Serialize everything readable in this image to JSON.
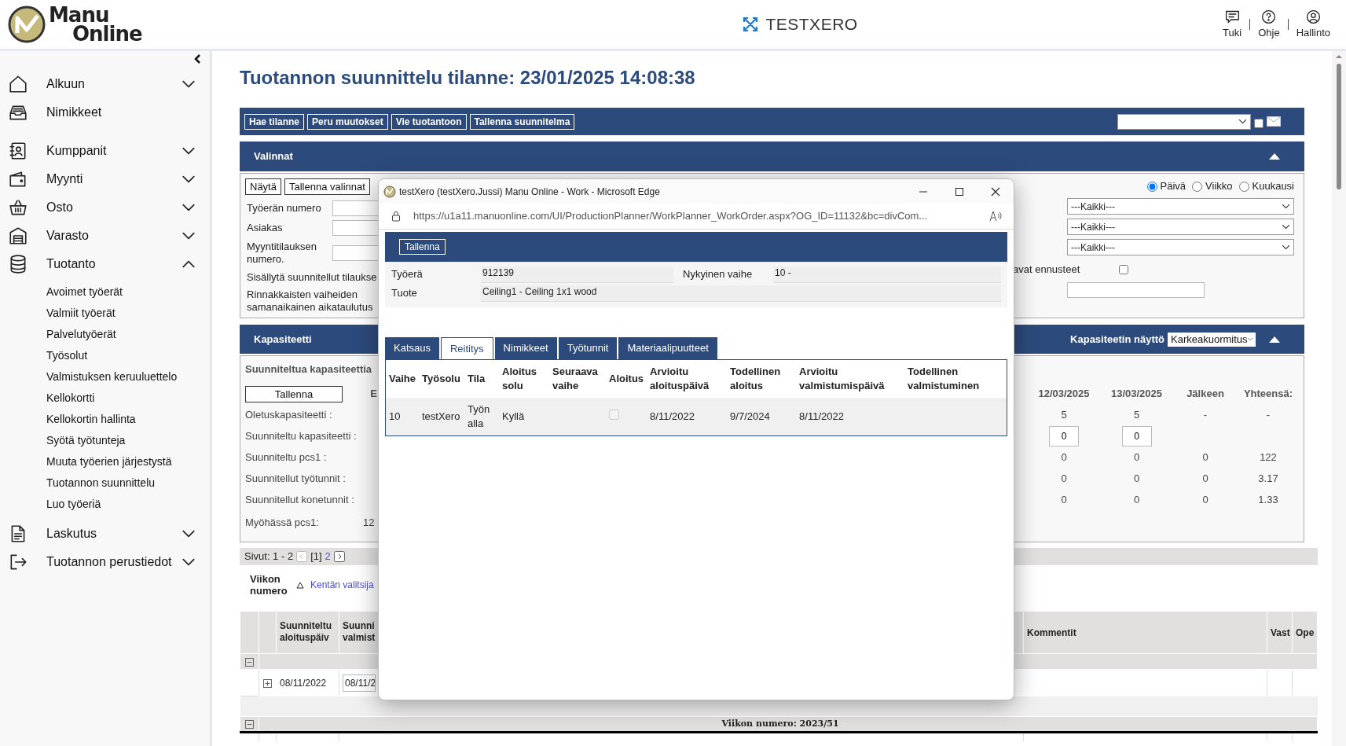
{
  "header": {
    "brand_top": "Manu",
    "brand_bottom": "Online",
    "company": "TESTXERO",
    "links": [
      {
        "label": "Tuki"
      },
      {
        "label": "Ohje"
      },
      {
        "label": "Hallinto"
      }
    ]
  },
  "sidebar": {
    "items": [
      {
        "label": "Alkuun",
        "kind": "group",
        "expanded": false
      },
      {
        "label": "Nimikkeet",
        "kind": "link"
      },
      {
        "label": "Kumppanit",
        "kind": "group",
        "expanded": false
      },
      {
        "label": "Myynti",
        "kind": "group",
        "expanded": false
      },
      {
        "label": "Osto",
        "kind": "group",
        "expanded": false
      },
      {
        "label": "Varasto",
        "kind": "group",
        "expanded": false
      },
      {
        "label": "Tuotanto",
        "kind": "group",
        "expanded": true,
        "children": [
          {
            "label": "Avoimet työerät"
          },
          {
            "label": "Valmiit työerät"
          },
          {
            "label": "Palvelutyöerät"
          },
          {
            "label": "Työsolut"
          },
          {
            "label": "Valmistuksen keruuluettelo"
          },
          {
            "label": "Kellokortti"
          },
          {
            "label": "Kellokortin hallinta"
          },
          {
            "label": "Syötä työtunteja"
          },
          {
            "label": "Muuta työerien järjestystä"
          },
          {
            "label": "Tuotannon suunnittelu"
          },
          {
            "label": "Luo työeriä"
          }
        ]
      },
      {
        "label": "Laskutus",
        "kind": "group",
        "expanded": false
      },
      {
        "label": "Tuotannon perustiedot",
        "kind": "group",
        "expanded": false
      }
    ]
  },
  "page_title": "Tuotannon suunnittelu tilanne: 23/01/2025 14:08:38",
  "toolbar": {
    "buttons": [
      "Hae tilanne",
      "Peru muutokset",
      "Vie tuotantoon",
      "Tallenna suunnitelma"
    ],
    "mail_checked": false
  },
  "selections": {
    "title": "Valinnat",
    "expanded": true,
    "buttons": [
      "Näytä",
      "Tallenna valinnat"
    ],
    "fields": [
      {
        "label": "Työerän numero",
        "kind": "input"
      },
      {
        "label": "Asiakas",
        "kind": "input"
      },
      {
        "label": "Myyntitilauksen numero.",
        "kind": "input"
      },
      {
        "label": "Sisällytä suunnitellut tilaukse",
        "kind": "text"
      },
      {
        "label": "Rinnakkaisten vaiheiden samanaikainen aikataulutus",
        "kind": "text"
      }
    ],
    "period": [
      {
        "label": "Päivä",
        "selected": true
      },
      {
        "label": "Viikko",
        "selected": false
      },
      {
        "label": "Kuukausi",
        "selected": false
      }
    ],
    "filters": [
      "---Kaikki---",
      "---Kaikki---",
      "---Kaikki---"
    ],
    "forecast": {
      "label": "avat ennusteet",
      "checked": false
    }
  },
  "capacity": {
    "title": "Kapasiteetti",
    "expanded": true,
    "view_label": "Kapasiteetin näyttö",
    "view_value": "Karkeakuormitus",
    "heading": "Suunniteltua kapasiteettia",
    "save_button": "Tallenna",
    "cut_heading": "E",
    "columns": [
      "12/03/2025",
      "13/03/2025",
      "Jälkeen",
      "Yhteensä:"
    ],
    "rows": [
      {
        "label": "Oletuskapasiteetti :",
        "kind": "text",
        "cells": [
          "5",
          "5",
          "-",
          "-"
        ]
      },
      {
        "label": "Suunniteltu kapasiteetti :",
        "kind": "input",
        "cells": [
          "0",
          "0"
        ]
      },
      {
        "label": "Suunniteltu pcs1 :",
        "kind": "text",
        "cells": [
          "0",
          "0",
          "0",
          "122"
        ]
      },
      {
        "label": "Suunnitellut työtunnit :",
        "kind": "text",
        "cells": [
          "0",
          "0",
          "0",
          "3.17"
        ]
      },
      {
        "label": "Suunnitellut konetunnit :",
        "kind": "text",
        "cells": [
          "0",
          "0",
          "0",
          "1.33"
        ]
      }
    ],
    "late_label": "Myöhässä pcs1:",
    "late_value": "12"
  },
  "pager": {
    "label": "Sivut: 1 - 2",
    "pages": [
      {
        "label": "[1]",
        "selected": true
      },
      {
        "label": "2",
        "selected": false
      }
    ]
  },
  "week_sort": {
    "label": "Viikon numero",
    "link": "Kentän valitsija"
  },
  "grid": {
    "columns": [
      "Suunniteltu aloituspäiv",
      "Suunni valmist",
      "Kommentit",
      "Vast",
      "Ope"
    ],
    "groups": [
      {
        "expanded": true,
        "rows": [
          {
            "expanded": false,
            "start": "08/11/2022",
            "finish": "08/11/2"
          }
        ]
      },
      {
        "expanded": true,
        "label": "Viikon numero: 2023/51"
      }
    ]
  },
  "popup": {
    "title": "testXero (testXero.Jussi) Manu Online - Work - Microsoft Edge",
    "url": "https://u1a11.manuonline.com/UI/ProductionPlanner/WorkPlanner_WorkOrder.aspx?OG_ID=11132&bc=divCom...",
    "save_button": "Tallenna",
    "fields": [
      {
        "label": "Työerä",
        "value": "912139"
      },
      {
        "label": "Nykyinen vaihe",
        "value": "10 -"
      },
      {
        "label": "Tuote",
        "value": "Ceiling1 - Ceiling 1x1 wood"
      }
    ],
    "tabs": [
      {
        "label": "Katsaus",
        "selected": false
      },
      {
        "label": "Reititys",
        "selected": true
      },
      {
        "label": "Nimikkeet",
        "selected": false
      },
      {
        "label": "Työtunnit",
        "selected": false
      },
      {
        "label": "Materiaalipuutteet",
        "selected": false
      }
    ],
    "columns": [
      "Vaihe",
      "Työsolu",
      "Tila",
      "Aloitus solu",
      "Seuraava vaihe",
      "Aloitus",
      "Arvioitu aloituspäivä",
      "Todellinen aloitus",
      "Arvioitu valmistumispäivä",
      "Todellinen valmistuminen"
    ],
    "rows": [
      {
        "phase": "10",
        "cell": "testXero",
        "status": "Työn alla",
        "start_cell": "Kyllä",
        "start_checked": false,
        "est_start": "8/11/2022",
        "actual_start": "9/7/2024",
        "est_finish": "8/11/2022"
      }
    ]
  }
}
